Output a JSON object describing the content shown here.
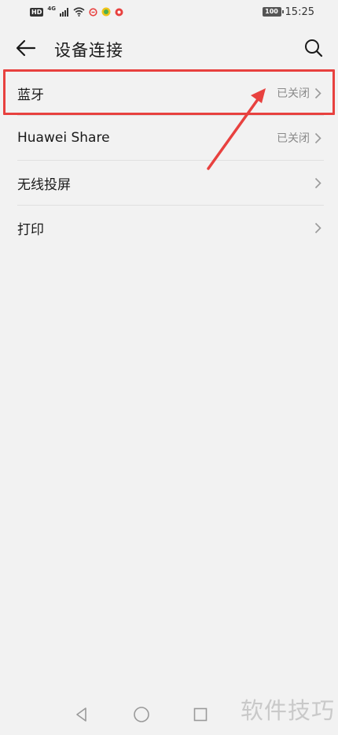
{
  "status_bar": {
    "hd_badge": "HD",
    "network": "4G",
    "battery": "100",
    "time": "15:25"
  },
  "toolbar": {
    "title": "设备连接",
    "back_icon": "back-arrow-icon",
    "search_icon": "search-icon"
  },
  "list": {
    "items": [
      {
        "label": "蓝牙",
        "status": "已关闭"
      },
      {
        "label": "Huawei Share",
        "status": "已关闭"
      },
      {
        "label": "无线投屏",
        "status": ""
      },
      {
        "label": "打印",
        "status": ""
      }
    ]
  },
  "watermark": "软件技巧",
  "colors": {
    "background": "#f2f2f2",
    "highlight": "#e8413f",
    "secondary_text": "#8a8a8a"
  }
}
